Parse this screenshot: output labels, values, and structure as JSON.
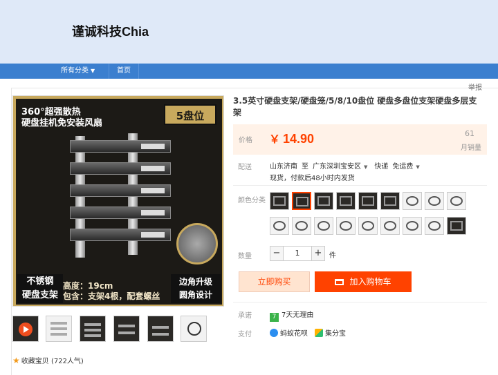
{
  "shop": {
    "name": "谨诚科技Chia"
  },
  "nav": {
    "all_categories": "所有分类",
    "home": "首页"
  },
  "report": "举报",
  "product": {
    "title": "3.5英寸硬盘支架/硬盘笼/5/8/10盘位 硬盘多盘位支架硬盘多层支架",
    "image": {
      "line1": "360°超强散热",
      "line2": "硬盘挂机免安装风扇",
      "badge": "5盘位",
      "bottom_left_1": "不锈钢",
      "bottom_left_2": "硬盘支架",
      "height_text": "高度：19cm",
      "include_text": "包含：支架4根，配套螺丝",
      "bottom_right_1": "边角升级",
      "bottom_right_2": "圆角设计"
    },
    "favorite": "收藏宝贝 (722人气)"
  },
  "price": {
    "label": "价格",
    "currency": "￥",
    "value": "14.90",
    "sales_count": "61",
    "sales_label": "月销量"
  },
  "shipping": {
    "label": "配送",
    "from": "山东济南",
    "to_word": "至",
    "to": "广东深圳宝安区",
    "method": "快递",
    "fee": "免运费",
    "note": "现货，付款后48小时内发货"
  },
  "options": {
    "label": "颜色分类",
    "selected_index": 1,
    "count": 18
  },
  "quantity": {
    "label": "数量",
    "value": "1",
    "unit": "件",
    "minus": "−",
    "plus": "+"
  },
  "actions": {
    "buy_now": "立即购买",
    "add_to_cart": "加入购物车"
  },
  "promise": {
    "label": "承诺",
    "icon_text": "7",
    "text": "7天无理由"
  },
  "payment": {
    "label": "支付",
    "methods": [
      "蚂蚁花呗",
      "集分宝"
    ]
  },
  "colors": {
    "accent": "#ff4200",
    "nav_bg": "#3b7fcf",
    "header_bg": "#dfe9f8",
    "price_bg": "#fff2e8"
  }
}
